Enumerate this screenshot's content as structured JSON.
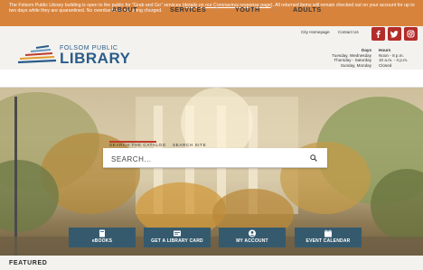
{
  "alert": {
    "text_before": "The Folsom Public Library building is open to the public for \"Grab and Go\" services (",
    "link_text": "details on our Coronavirus response page",
    "text_after": "). All returned items will remain checked out on your account for up to two days while they are quarantined. No overdue fines are being charged."
  },
  "header": {
    "logo_small": "FOLSOM PUBLIC",
    "logo_big": "LIBRARY",
    "util_links": [
      "City Homepage",
      "Contact Us"
    ],
    "social_icons": [
      "facebook-icon",
      "twitter-icon",
      "instagram-icon"
    ],
    "hours": {
      "days_title": "Days",
      "hours_title": "Hours",
      "days": [
        "Tuesday, Wednesday",
        "Thursday - Saturday",
        "Sunday, Monday"
      ],
      "hours": [
        "Noon - 8 p.m.",
        "10 a.m. - 4 p.m.",
        "Closed"
      ]
    }
  },
  "nav": {
    "items": [
      "ABOUT",
      "SERVICES",
      "YOUTH",
      "ADULTS"
    ],
    "separator": "|"
  },
  "search": {
    "tabs": [
      "SEARCH THE CATALOG",
      "SEARCH SITE"
    ],
    "placeholder": "SEARCH...",
    "icon": "search-icon"
  },
  "quick_links": [
    {
      "label": "eBOOKS",
      "icon": "ebook-icon"
    },
    {
      "label": "GET A LIBRARY CARD",
      "icon": "library-card-icon"
    },
    {
      "label": "MY ACCOUNT",
      "icon": "account-icon"
    },
    {
      "label": "EVENT CALENDAR",
      "icon": "calendar-icon"
    }
  ],
  "featured": {
    "heading": "FEATURED"
  },
  "colors": {
    "alert_bg": "#d8833c",
    "header_bg": "#f3f2ee",
    "logo": "#2a5c8a",
    "social": "#b32d2a",
    "tile_bg": "#355a6e",
    "search_accent": "#c0392b"
  }
}
